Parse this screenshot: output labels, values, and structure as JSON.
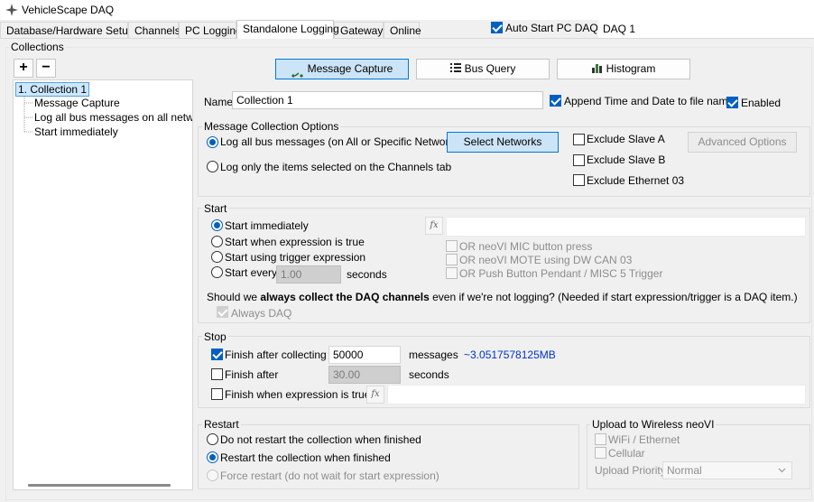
{
  "window": {
    "title": "VehicleScape DAQ"
  },
  "tabs": [
    {
      "label": "Database/Hardware Setup"
    },
    {
      "label": "Channels"
    },
    {
      "label": "PC Logging"
    },
    {
      "label": "Standalone Logging",
      "active": true
    },
    {
      "label": "Gateway"
    },
    {
      "label": "Online"
    }
  ],
  "auto_start": {
    "label": "Auto Start PC DAQ",
    "checked": true,
    "value": "DAQ 1"
  },
  "collections": {
    "group_label": "Collections",
    "add_label": "+",
    "remove_label": "−",
    "tree": {
      "root": "1. Collection 1",
      "children": [
        "Message Capture",
        "Log all bus messages on all networks",
        "Start immediately"
      ]
    }
  },
  "toolbar": {
    "message_capture": "Message Capture",
    "bus_query": "Bus Query",
    "histogram": "Histogram"
  },
  "name_row": {
    "label": "Name",
    "value": "Collection 1",
    "append_label": "Append Time and Date to file name",
    "append_checked": true,
    "enabled_label": "Enabled",
    "enabled_checked": true
  },
  "message_options": {
    "title": "Message Collection Options",
    "log_all": "Log all bus messages (on All or Specific Networks)",
    "log_only": "Log only the items selected on the Channels tab",
    "select_networks": "Select Networks",
    "exclude_slave_a": "Exclude Slave A",
    "exclude_slave_b": "Exclude Slave B",
    "exclude_ethernet": "Exclude Ethernet 03",
    "advanced": "Advanced Options"
  },
  "start": {
    "title": "Start",
    "immediately": "Start immediately",
    "expression": "Start when expression is true",
    "trigger": "Start using trigger expression",
    "every": "Start every",
    "every_value": "1.00",
    "seconds": "seconds",
    "fx": "fx",
    "mic": "OR neoVI MIC button press",
    "mote": "OR neoVI MOTE using DW CAN 03",
    "pendant": "OR Push Button Pendant / MISC 5 Trigger",
    "question_pre": "Should we ",
    "question_bold": "always collect the DAQ channels",
    "question_post": " even if we're not logging? (Needed if start expression/trigger is a DAQ item.)",
    "always_daq": "Always DAQ"
  },
  "stop": {
    "title": "Stop",
    "finish_collecting": "Finish after collecting",
    "collect_value": "50000",
    "messages": "messages",
    "size": "~3.0517578125MB",
    "finish_after": "Finish after",
    "after_value": "30.00",
    "seconds": "seconds",
    "finish_expr": "Finish when expression is true",
    "fx": "fx"
  },
  "restart": {
    "title": "Restart",
    "no_restart": "Do not restart the collection when finished",
    "restart": "Restart the collection when finished",
    "force": "Force restart (do not wait for start expression)"
  },
  "upload": {
    "title": "Upload to Wireless neoVI",
    "wifi": "WiFi / Ethernet",
    "cellular": "Cellular",
    "priority_label": "Upload Priority",
    "priority_value": "Normal"
  },
  "colors": {
    "accent": "#0060c0",
    "size_text": "#0033cc",
    "selection": "#cce8ff"
  }
}
